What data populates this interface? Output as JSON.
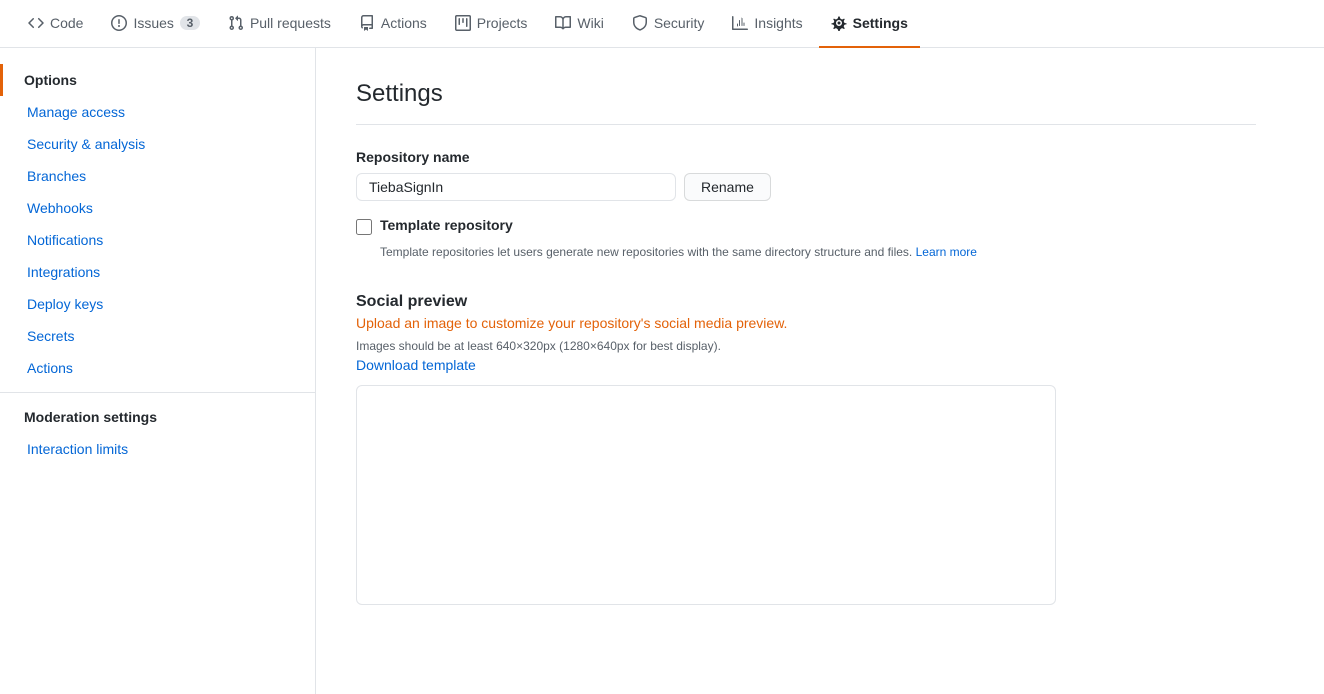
{
  "nav": {
    "items": [
      {
        "id": "code",
        "label": "Code",
        "icon": "code",
        "active": false,
        "badge": null
      },
      {
        "id": "issues",
        "label": "Issues",
        "icon": "issue",
        "active": false,
        "badge": "3"
      },
      {
        "id": "pull-requests",
        "label": "Pull requests",
        "icon": "pr",
        "active": false,
        "badge": null
      },
      {
        "id": "actions",
        "label": "Actions",
        "icon": "actions",
        "active": false,
        "badge": null
      },
      {
        "id": "projects",
        "label": "Projects",
        "icon": "projects",
        "active": false,
        "badge": null
      },
      {
        "id": "wiki",
        "label": "Wiki",
        "icon": "wiki",
        "active": false,
        "badge": null
      },
      {
        "id": "security",
        "label": "Security",
        "icon": "security",
        "active": false,
        "badge": null
      },
      {
        "id": "insights",
        "label": "Insights",
        "icon": "insights",
        "active": false,
        "badge": null
      },
      {
        "id": "settings",
        "label": "Settings",
        "icon": "settings",
        "active": true,
        "badge": null
      }
    ]
  },
  "sidebar": {
    "items": [
      {
        "id": "options",
        "label": "Options",
        "active": true,
        "section": "main"
      },
      {
        "id": "manage-access",
        "label": "Manage access",
        "active": false,
        "section": "main"
      },
      {
        "id": "security-analysis",
        "label": "Security & analysis",
        "active": false,
        "section": "main"
      },
      {
        "id": "branches",
        "label": "Branches",
        "active": false,
        "section": "main"
      },
      {
        "id": "webhooks",
        "label": "Webhooks",
        "active": false,
        "section": "main"
      },
      {
        "id": "notifications",
        "label": "Notifications",
        "active": false,
        "section": "main"
      },
      {
        "id": "integrations",
        "label": "Integrations",
        "active": false,
        "section": "main"
      },
      {
        "id": "deploy-keys",
        "label": "Deploy keys",
        "active": false,
        "section": "main"
      },
      {
        "id": "secrets",
        "label": "Secrets",
        "active": false,
        "section": "main"
      },
      {
        "id": "actions",
        "label": "Actions",
        "active": false,
        "section": "main"
      }
    ],
    "moderation": {
      "header": "Moderation settings",
      "items": [
        {
          "id": "interaction-limits",
          "label": "Interaction limits",
          "active": false
        }
      ]
    }
  },
  "content": {
    "page_title": "Settings",
    "repo_name_section": {
      "label": "Repository name",
      "value": "TiebaSignIn",
      "rename_button": "Rename"
    },
    "template_repo": {
      "label": "Template repository",
      "description": "Template repositories let users generate new repositories with the same directory structure and files.",
      "learn_more": "Learn more",
      "learn_more_url": "#"
    },
    "social_preview": {
      "title": "Social preview",
      "upload_text": "Upload an image to customize your repository's social media preview.",
      "hint": "Images should be at least 640×320px (1280×640px for best display).",
      "download_label": "Download template"
    }
  }
}
